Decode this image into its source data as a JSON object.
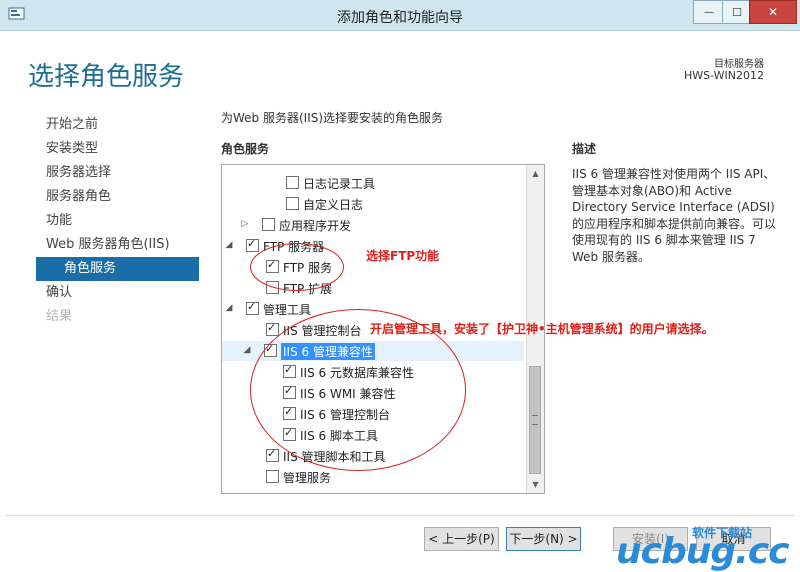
{
  "window": {
    "title": "添加角色和功能向导",
    "minimize_glyph": "—",
    "maximize_glyph": "☐",
    "close_glyph": "✕"
  },
  "header": {
    "page_title": "选择角色服务",
    "destination_label": "目标服务器",
    "destination_server": "HWS-WIN2012"
  },
  "nav": {
    "items": [
      {
        "label": "开始之前",
        "state": "normal"
      },
      {
        "label": "安装类型",
        "state": "normal"
      },
      {
        "label": "服务器选择",
        "state": "normal"
      },
      {
        "label": "服务器角色",
        "state": "normal"
      },
      {
        "label": "功能",
        "state": "normal"
      },
      {
        "label": "Web 服务器角色(IIS)",
        "state": "normal"
      },
      {
        "label": "角色服务",
        "state": "active"
      },
      {
        "label": "确认",
        "state": "normal"
      },
      {
        "label": "结果",
        "state": "disabled"
      }
    ]
  },
  "main": {
    "instruction": "为Web 服务器(IIS)选择要安装的角色服务",
    "column_header": "角色服务",
    "description_header": "描述",
    "description_text": "IIS 6 管理兼容性对使用两个 IIS API、管理基本对象(ABO)和 Active Directory Service Interface (ADSI) 的应用程序和脚本提供前向兼容。可以使用现有的 IIS 6 脚本来管理 IIS 7 Web 服务器。",
    "tree": [
      {
        "label": "日志记录工具",
        "checked": false,
        "expander": ""
      },
      {
        "label": "自定义日志",
        "checked": false,
        "expander": ""
      },
      {
        "label": "应用程序开发",
        "checked": false,
        "expander": "▷"
      },
      {
        "label": "FTP 服务器",
        "checked": true,
        "expander": "◢"
      },
      {
        "label": "FTP 服务",
        "checked": true,
        "expander": ""
      },
      {
        "label": "FTP 扩展",
        "checked": false,
        "expander": ""
      },
      {
        "label": "管理工具",
        "checked": true,
        "expander": "◢"
      },
      {
        "label": "IIS 管理控制台",
        "checked": true,
        "expander": ""
      },
      {
        "label": "IIS 6 管理兼容性",
        "checked": true,
        "expander": "◢"
      },
      {
        "label": "IIS 6 元数据库兼容性",
        "checked": true,
        "expander": ""
      },
      {
        "label": "IIS 6 WMI 兼容性",
        "checked": true,
        "expander": ""
      },
      {
        "label": "IIS 6 管理控制台",
        "checked": true,
        "expander": ""
      },
      {
        "label": "IIS 6 脚本工具",
        "checked": true,
        "expander": ""
      },
      {
        "label": "IIS 管理脚本和工具",
        "checked": true,
        "expander": ""
      },
      {
        "label": "管理服务",
        "checked": false,
        "expander": ""
      }
    ],
    "scrollbar": {
      "up_glyph": "▲",
      "down_glyph": "▼"
    }
  },
  "annotations": {
    "ftp": "选择FTP功能",
    "mgmt": "开启管理工具，安装了【护卫神•主机管理系统】的用户请选择。"
  },
  "footer": {
    "prev_label": "< 上一步(P)",
    "next_label": "下一步(N) >",
    "install_label": "安装(I)",
    "cancel_label": "取消"
  },
  "watermark": {
    "brand": "ucbug.cc",
    "tagline": "软件下载站"
  },
  "colors": {
    "title_blue": "#1d6e94",
    "nav_active": "#1a6ea8",
    "annotation_red": "#e0201a",
    "close_red": "#c7453c"
  }
}
